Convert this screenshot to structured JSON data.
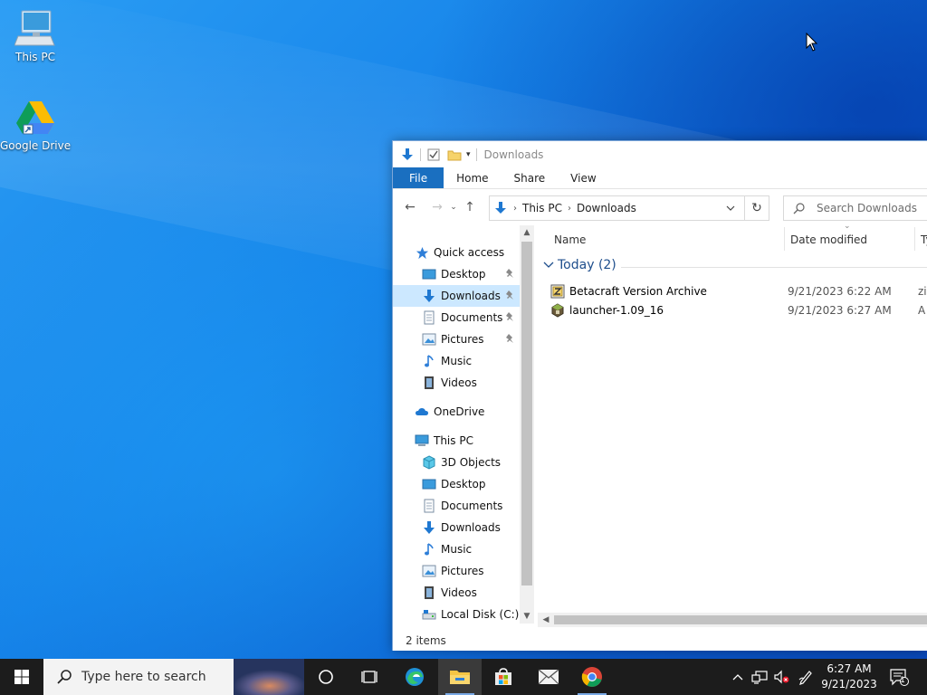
{
  "desktop": {
    "icons": [
      {
        "label": "This PC"
      },
      {
        "label": "Google Drive"
      }
    ]
  },
  "explorer": {
    "title": "Downloads",
    "ribbon_tabs": [
      "File",
      "Home",
      "Share",
      "View"
    ],
    "address": {
      "segments": [
        "This PC",
        "Downloads"
      ]
    },
    "search": {
      "placeholder": "Search Downloads"
    },
    "nav": {
      "quick_access": "Quick access",
      "quick_items": [
        "Desktop",
        "Downloads",
        "Documents",
        "Pictures",
        "Music",
        "Videos"
      ],
      "onedrive": "OneDrive",
      "this_pc": "This PC",
      "pc_items": [
        "3D Objects",
        "Desktop",
        "Documents",
        "Downloads",
        "Music",
        "Pictures",
        "Videos",
        "Local Disk (C:)"
      ]
    },
    "columns": {
      "name": "Name",
      "date": "Date modified",
      "type": "Ty"
    },
    "group": {
      "label": "Today (2)"
    },
    "files": [
      {
        "name": "Betacraft Version Archive",
        "date": "9/21/2023 6:22 AM",
        "type": "zi"
      },
      {
        "name": "launcher-1.09_16",
        "date": "9/21/2023 6:27 AM",
        "type": "A"
      }
    ],
    "status": {
      "items": "2 items"
    }
  },
  "taskbar": {
    "search_placeholder": "Type here to search",
    "clock": {
      "time": "6:27 AM",
      "date": "9/21/2023"
    },
    "notifications_count": "1"
  },
  "colors": {
    "accent": "#1a6fc0",
    "selected": "#cce8ff",
    "taskbar": "#1c1c1c"
  }
}
